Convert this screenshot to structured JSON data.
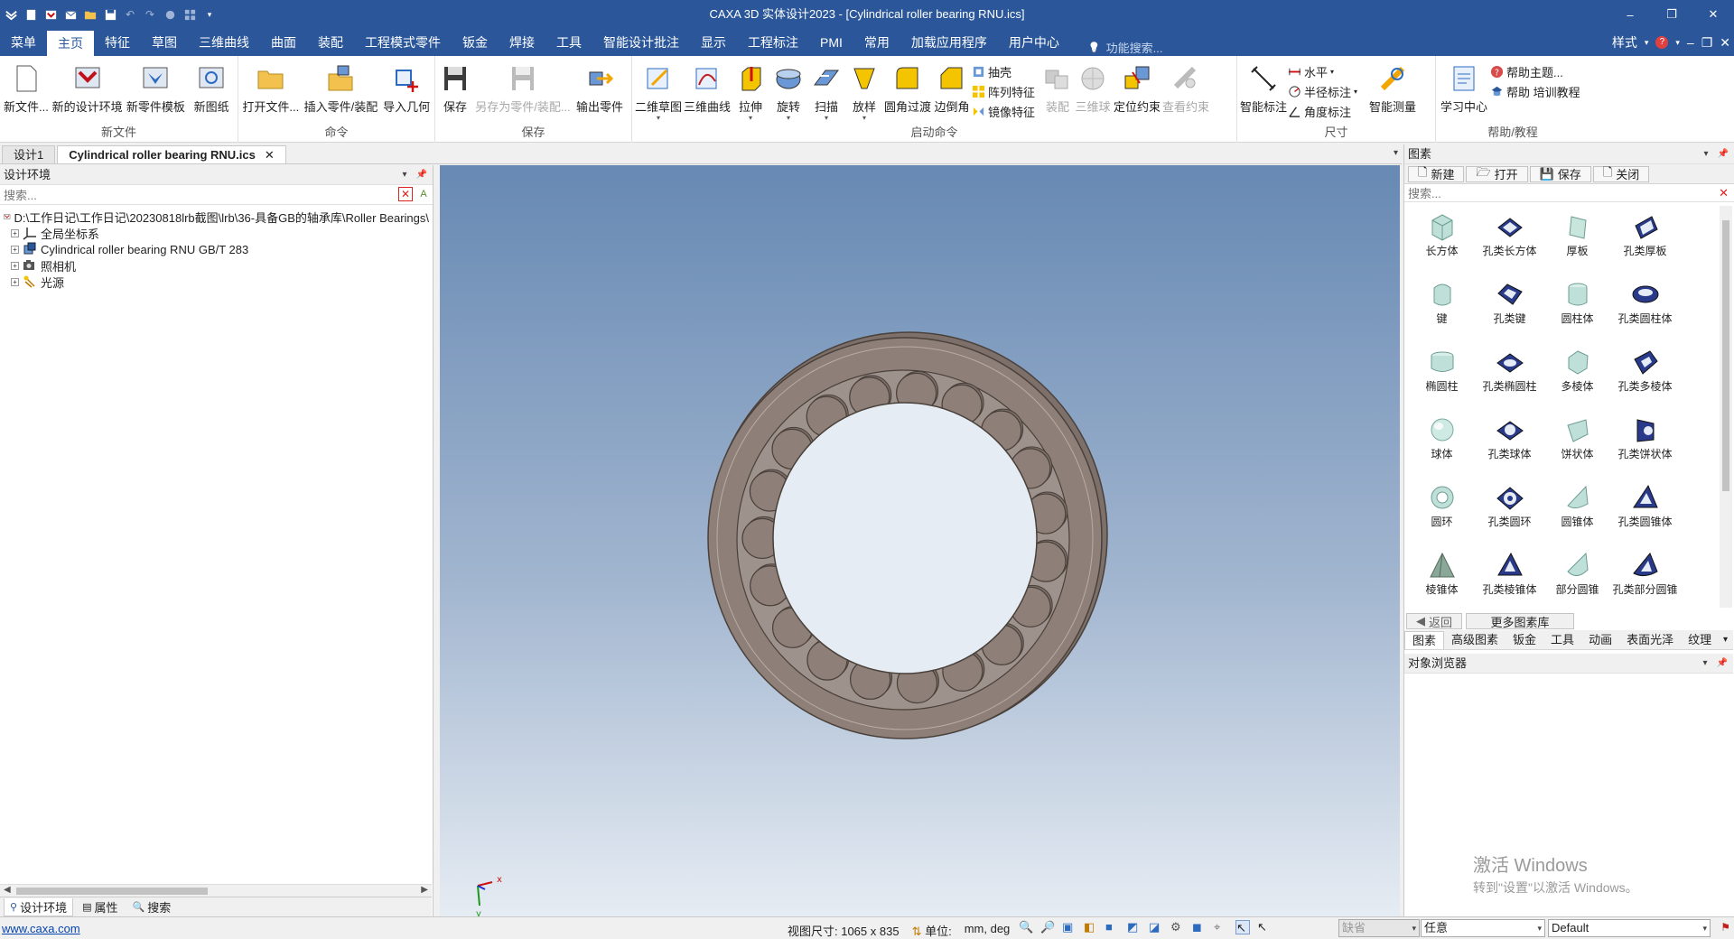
{
  "title": {
    "text": "CAXA 3D 实体设计2023 - [Cylindrical roller bearing RNU.ics]"
  },
  "menu": {
    "tabs": [
      "菜单",
      "主页",
      "特征",
      "草图",
      "三维曲线",
      "曲面",
      "装配",
      "工程模式零件",
      "钣金",
      "焊接",
      "工具",
      "智能设计批注",
      "显示",
      "工程标注",
      "PMI",
      "常用",
      "加载应用程序",
      "用户中心"
    ],
    "active": "主页",
    "search_placeholder": "功能搜索...",
    "style_label": "样式"
  },
  "ribbon": {
    "groups": [
      {
        "label": "新文件",
        "buttons": [
          "新文件...",
          "新的设计环境",
          "新零件模板",
          "新图纸"
        ]
      },
      {
        "label": "命令",
        "buttons": [
          "打开文件...",
          "插入零件/装配",
          "导入几何"
        ]
      },
      {
        "label": "保存",
        "buttons": [
          "保存",
          "另存为零件/装配...",
          "输出零件"
        ]
      },
      {
        "label": "启动命令",
        "buttons": [
          "二维草图",
          "三维曲线",
          "拉伸",
          "旋转",
          "扫描",
          "放样",
          "圆角过渡",
          "边倒角"
        ],
        "small": [
          "抽壳",
          "阵列特征",
          "镜像特征"
        ],
        "more": [
          "装配",
          "三维球",
          "定位约束",
          "查看约束"
        ]
      },
      {
        "label": "尺寸",
        "buttons": [
          "智能标注"
        ],
        "small": [
          "水平",
          "半径标注",
          "角度标注"
        ],
        "more": [
          "智能测量"
        ]
      },
      {
        "label": "帮助/教程",
        "buttons": [
          "学习中心"
        ],
        "small": [
          "帮助主题...",
          "帮助 培训教程"
        ]
      }
    ]
  },
  "doctabs": {
    "tabs": [
      "设计1",
      "Cylindrical roller bearing RNU.ics"
    ]
  },
  "left_panel": {
    "title": "设计环境",
    "search_placeholder": "搜索...",
    "tree": [
      {
        "label": "D:\\工作日记\\工作日记\\20230818lrb截图\\lrb\\36-具备GB的轴承库\\Roller Bearings\\"
      },
      {
        "label": "全局坐标系"
      },
      {
        "label": "Cylindrical roller bearing RNU GB/T 283"
      },
      {
        "label": "照相机"
      },
      {
        "label": "光源"
      }
    ],
    "bottom_tabs": [
      "设计环境",
      "属性",
      "搜索"
    ]
  },
  "right_panel": {
    "title": "图素",
    "toolbar": [
      "新建",
      "打开",
      "保存",
      "关闭"
    ],
    "search_placeholder": "搜索...",
    "items": [
      "长方体",
      "孔类长方体",
      "厚板",
      "孔类厚板",
      "键",
      "孔类键",
      "圆柱体",
      "孔类圆柱体",
      "椭圆柱",
      "孔类椭圆柱",
      "多棱体",
      "孔类多棱体",
      "球体",
      "孔类球体",
      "饼状体",
      "孔类饼状体",
      "圆环",
      "孔类圆环",
      "圆锥体",
      "孔类圆锥体",
      "棱锥体",
      "孔类棱锥体",
      "部分圆锥",
      "孔类部分圆锥"
    ],
    "nav_back": "返回",
    "nav_more": "更多图素库",
    "categories": [
      "图素",
      "高级图素",
      "钣金",
      "工具",
      "动画",
      "表面光泽",
      "纹理"
    ],
    "object_browser_title": "对象浏览器",
    "watermark_1": "激活 Windows",
    "watermark_2": "转到\"设置\"以激活 Windows。"
  },
  "viewport": {
    "axis_x": "x",
    "axis_y": "y",
    "roller_count": 19,
    "colors": {
      "bearing": "#8e8078",
      "edge": "#4a403a"
    }
  },
  "status": {
    "link": "www.caxa.com",
    "view_size": "视图尺寸: 1065 x  835",
    "unit_label": "单位:",
    "unit_value": "mm, deg",
    "drop1": "缺省",
    "drop2": "任意",
    "drop3": "Default"
  },
  "colors": {
    "accent": "#2b579a"
  }
}
